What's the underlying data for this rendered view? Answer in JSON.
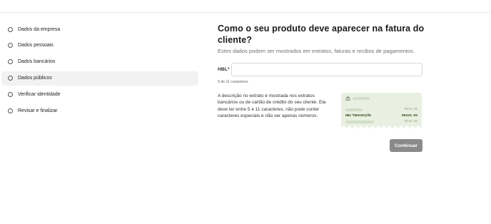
{
  "steps": [
    {
      "label": "Dados da empresa",
      "active": false
    },
    {
      "label": "Dados pessoais",
      "active": false
    },
    {
      "label": "Dados bancários",
      "active": false
    },
    {
      "label": "Dados públicos",
      "active": true
    },
    {
      "label": "Verificar identidade",
      "active": false
    },
    {
      "label": "Revisar e finalizar",
      "active": false
    }
  ],
  "main": {
    "title": "Como o seu produto deve aparecer na fatura do cliente?",
    "subtitle": "Estes dados podem ser mostrados em extratos, faturas e recibos de pagamentos."
  },
  "form": {
    "prefix_label": "HBL*",
    "input_value": "",
    "counter": "0 de 11 caracteres",
    "help": "A descrição no extrato é mostrada nos extratos bancários ou de cartão de crédito do seu cliente. Ela deve ter entre 5 e 11 caracteres, não pode conter caracteres especiais e não ser apenas números.",
    "submit_label": "Continuar"
  },
  "receipt": {
    "icon": "bank-icon",
    "amount_1": "R$10.00",
    "descriptor": "HBL*DESCRIÇÃO",
    "amount_highlight": "R$320.00",
    "amount_2": "R$10.00"
  },
  "colors": {
    "receipt_bg": "#e9f0e1",
    "button_bg": "#8a8a8a",
    "active_step_bg": "#f2f2f2"
  }
}
